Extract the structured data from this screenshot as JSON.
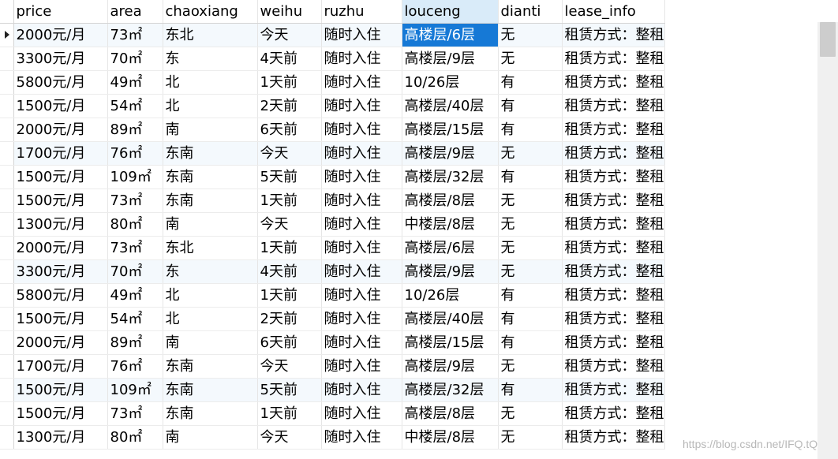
{
  "columns": [
    "price",
    "area",
    "chaoxiang",
    "weihu",
    "ruzhu",
    "louceng",
    "dianti",
    "lease_info"
  ],
  "rows": [
    [
      "2000元/月",
      "73㎡",
      "东北",
      "今天",
      "随时入住",
      "高楼层/6层",
      "无",
      "租赁方式：整租"
    ],
    [
      "3300元/月",
      "70㎡",
      "东",
      "4天前",
      "随时入住",
      "高楼层/9层",
      "无",
      "租赁方式：整租"
    ],
    [
      "5800元/月",
      "49㎡",
      "北",
      "1天前",
      "随时入住",
      "10/26层",
      "有",
      "租赁方式：整租"
    ],
    [
      "1500元/月",
      "54㎡",
      "北",
      "2天前",
      "随时入住",
      "高楼层/40层",
      "有",
      "租赁方式：整租"
    ],
    [
      "2000元/月",
      "89㎡",
      "南",
      "6天前",
      "随时入住",
      "高楼层/15层",
      "有",
      "租赁方式：整租"
    ],
    [
      "1700元/月",
      "76㎡",
      "东南",
      "今天",
      "随时入住",
      "高楼层/9层",
      "无",
      "租赁方式：整租"
    ],
    [
      "1500元/月",
      "109㎡",
      "东南",
      "5天前",
      "随时入住",
      "高楼层/32层",
      "有",
      "租赁方式：整租"
    ],
    [
      "1500元/月",
      "73㎡",
      "东南",
      "1天前",
      "随时入住",
      "高楼层/8层",
      "无",
      "租赁方式：整租"
    ],
    [
      "1300元/月",
      "80㎡",
      "南",
      "今天",
      "随时入住",
      "中楼层/8层",
      "无",
      "租赁方式：整租"
    ],
    [
      "2000元/月",
      "73㎡",
      "东北",
      "1天前",
      "随时入住",
      "高楼层/6层",
      "无",
      "租赁方式：整租"
    ],
    [
      "3300元/月",
      "70㎡",
      "东",
      "4天前",
      "随时入住",
      "高楼层/9层",
      "无",
      "租赁方式：整租"
    ],
    [
      "5800元/月",
      "49㎡",
      "北",
      "1天前",
      "随时入住",
      "10/26层",
      "有",
      "租赁方式：整租"
    ],
    [
      "1500元/月",
      "54㎡",
      "北",
      "2天前",
      "随时入住",
      "高楼层/40层",
      "有",
      "租赁方式：整租"
    ],
    [
      "2000元/月",
      "89㎡",
      "南",
      "6天前",
      "随时入住",
      "高楼层/15层",
      "有",
      "租赁方式：整租"
    ],
    [
      "1700元/月",
      "76㎡",
      "东南",
      "今天",
      "随时入住",
      "高楼层/9层",
      "无",
      "租赁方式：整租"
    ],
    [
      "1500元/月",
      "109㎡",
      "东南",
      "5天前",
      "随时入住",
      "高楼层/32层",
      "有",
      "租赁方式：整租"
    ],
    [
      "1500元/月",
      "73㎡",
      "东南",
      "1天前",
      "随时入住",
      "高楼层/8层",
      "无",
      "租赁方式：整租"
    ],
    [
      "1300元/月",
      "80㎡",
      "南",
      "今天",
      "随时入住",
      "中楼层/8层",
      "无",
      "租赁方式：整租"
    ]
  ],
  "sorted_column": "louceng",
  "selected_cell": {
    "row": 0,
    "column": "louceng"
  },
  "watermark": "https://blog.csdn.net/IFQ.tQ",
  "colors": {
    "selected": "#1679d6",
    "sorted_header": "#d9ebf9",
    "alt_row": "#f4f9fd"
  }
}
